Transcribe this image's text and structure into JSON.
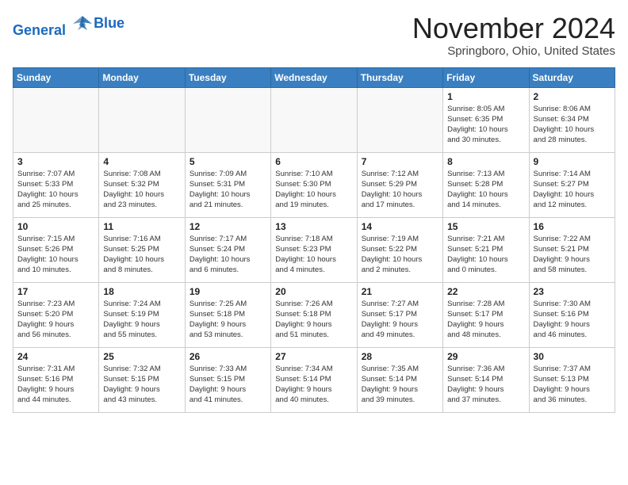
{
  "header": {
    "logo_line1": "General",
    "logo_line2": "Blue",
    "month_title": "November 2024",
    "location": "Springboro, Ohio, United States"
  },
  "calendar": {
    "days_of_week": [
      "Sunday",
      "Monday",
      "Tuesday",
      "Wednesday",
      "Thursday",
      "Friday",
      "Saturday"
    ],
    "weeks": [
      [
        {
          "day": "",
          "info": ""
        },
        {
          "day": "",
          "info": ""
        },
        {
          "day": "",
          "info": ""
        },
        {
          "day": "",
          "info": ""
        },
        {
          "day": "",
          "info": ""
        },
        {
          "day": "1",
          "info": "Sunrise: 8:05 AM\nSunset: 6:35 PM\nDaylight: 10 hours\nand 30 minutes."
        },
        {
          "day": "2",
          "info": "Sunrise: 8:06 AM\nSunset: 6:34 PM\nDaylight: 10 hours\nand 28 minutes."
        }
      ],
      [
        {
          "day": "3",
          "info": "Sunrise: 7:07 AM\nSunset: 5:33 PM\nDaylight: 10 hours\nand 25 minutes."
        },
        {
          "day": "4",
          "info": "Sunrise: 7:08 AM\nSunset: 5:32 PM\nDaylight: 10 hours\nand 23 minutes."
        },
        {
          "day": "5",
          "info": "Sunrise: 7:09 AM\nSunset: 5:31 PM\nDaylight: 10 hours\nand 21 minutes."
        },
        {
          "day": "6",
          "info": "Sunrise: 7:10 AM\nSunset: 5:30 PM\nDaylight: 10 hours\nand 19 minutes."
        },
        {
          "day": "7",
          "info": "Sunrise: 7:12 AM\nSunset: 5:29 PM\nDaylight: 10 hours\nand 17 minutes."
        },
        {
          "day": "8",
          "info": "Sunrise: 7:13 AM\nSunset: 5:28 PM\nDaylight: 10 hours\nand 14 minutes."
        },
        {
          "day": "9",
          "info": "Sunrise: 7:14 AM\nSunset: 5:27 PM\nDaylight: 10 hours\nand 12 minutes."
        }
      ],
      [
        {
          "day": "10",
          "info": "Sunrise: 7:15 AM\nSunset: 5:26 PM\nDaylight: 10 hours\nand 10 minutes."
        },
        {
          "day": "11",
          "info": "Sunrise: 7:16 AM\nSunset: 5:25 PM\nDaylight: 10 hours\nand 8 minutes."
        },
        {
          "day": "12",
          "info": "Sunrise: 7:17 AM\nSunset: 5:24 PM\nDaylight: 10 hours\nand 6 minutes."
        },
        {
          "day": "13",
          "info": "Sunrise: 7:18 AM\nSunset: 5:23 PM\nDaylight: 10 hours\nand 4 minutes."
        },
        {
          "day": "14",
          "info": "Sunrise: 7:19 AM\nSunset: 5:22 PM\nDaylight: 10 hours\nand 2 minutes."
        },
        {
          "day": "15",
          "info": "Sunrise: 7:21 AM\nSunset: 5:21 PM\nDaylight: 10 hours\nand 0 minutes."
        },
        {
          "day": "16",
          "info": "Sunrise: 7:22 AM\nSunset: 5:21 PM\nDaylight: 9 hours\nand 58 minutes."
        }
      ],
      [
        {
          "day": "17",
          "info": "Sunrise: 7:23 AM\nSunset: 5:20 PM\nDaylight: 9 hours\nand 56 minutes."
        },
        {
          "day": "18",
          "info": "Sunrise: 7:24 AM\nSunset: 5:19 PM\nDaylight: 9 hours\nand 55 minutes."
        },
        {
          "day": "19",
          "info": "Sunrise: 7:25 AM\nSunset: 5:18 PM\nDaylight: 9 hours\nand 53 minutes."
        },
        {
          "day": "20",
          "info": "Sunrise: 7:26 AM\nSunset: 5:18 PM\nDaylight: 9 hours\nand 51 minutes."
        },
        {
          "day": "21",
          "info": "Sunrise: 7:27 AM\nSunset: 5:17 PM\nDaylight: 9 hours\nand 49 minutes."
        },
        {
          "day": "22",
          "info": "Sunrise: 7:28 AM\nSunset: 5:17 PM\nDaylight: 9 hours\nand 48 minutes."
        },
        {
          "day": "23",
          "info": "Sunrise: 7:30 AM\nSunset: 5:16 PM\nDaylight: 9 hours\nand 46 minutes."
        }
      ],
      [
        {
          "day": "24",
          "info": "Sunrise: 7:31 AM\nSunset: 5:16 PM\nDaylight: 9 hours\nand 44 minutes."
        },
        {
          "day": "25",
          "info": "Sunrise: 7:32 AM\nSunset: 5:15 PM\nDaylight: 9 hours\nand 43 minutes."
        },
        {
          "day": "26",
          "info": "Sunrise: 7:33 AM\nSunset: 5:15 PM\nDaylight: 9 hours\nand 41 minutes."
        },
        {
          "day": "27",
          "info": "Sunrise: 7:34 AM\nSunset: 5:14 PM\nDaylight: 9 hours\nand 40 minutes."
        },
        {
          "day": "28",
          "info": "Sunrise: 7:35 AM\nSunset: 5:14 PM\nDaylight: 9 hours\nand 39 minutes."
        },
        {
          "day": "29",
          "info": "Sunrise: 7:36 AM\nSunset: 5:14 PM\nDaylight: 9 hours\nand 37 minutes."
        },
        {
          "day": "30",
          "info": "Sunrise: 7:37 AM\nSunset: 5:13 PM\nDaylight: 9 hours\nand 36 minutes."
        }
      ]
    ]
  }
}
